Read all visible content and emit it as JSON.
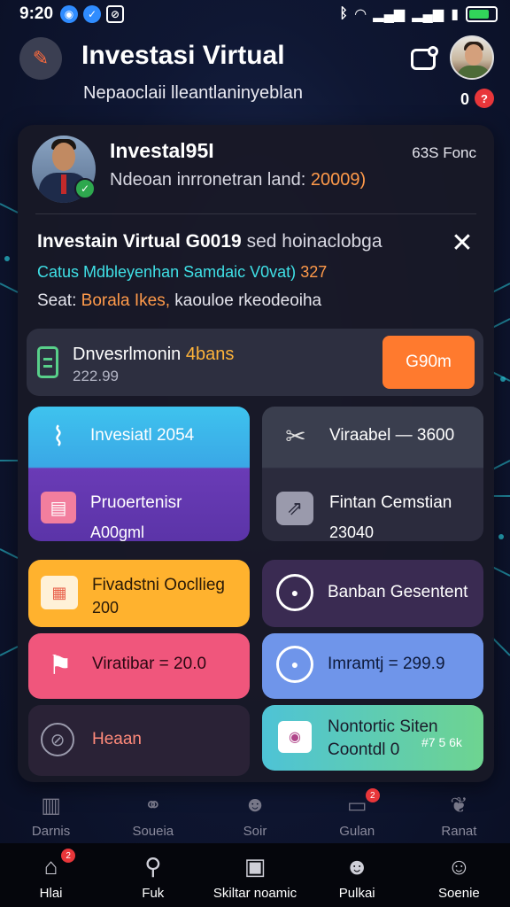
{
  "status_bar": {
    "time": "9:20"
  },
  "header": {
    "title": "Investasi Virtual",
    "subtitle": "Nepaoclaii lleantlaninyeblan",
    "notif_count": "0",
    "notif_badge": "?"
  },
  "profile": {
    "name": "Investal95I",
    "desc_prefix": "Ndeoan inrronetran land: ",
    "desc_value": "20009)",
    "meta": "63S Fonc"
  },
  "info": {
    "title_bold": "Investain Virtual G0019",
    "title_rest": "sed hoinaclobga",
    "line2_prefix": "Catus Mdbleyenhan Samdaic V0vat)",
    "line2_value": "327",
    "line3_prefix": "Seat: ",
    "line3_highlight": "Borala Ikes,",
    "line3_rest": " kaouloe rkeodeoiha",
    "close_label": "✕"
  },
  "invest_row": {
    "title": "Dnvesrlmonin",
    "title_value": "4bans",
    "sub": "222.99",
    "button_label": "G90m"
  },
  "tiles": [
    {
      "label": "Invesiatl 2054"
    },
    {
      "label": "Viraabel — 3600"
    },
    {
      "label": "Pruoertenisr",
      "value": "A00gml"
    },
    {
      "label": "Fintan Cemstian",
      "value": "23040"
    },
    {
      "label": "Fivadstni Oocllieg",
      "value": "200"
    },
    {
      "label": "Banban Gesentent"
    },
    {
      "label": "Viratibar = 20.0"
    },
    {
      "label": "Imramtj = 299.9"
    },
    {
      "label": "Heaan"
    },
    {
      "label": "Nontortic Siten",
      "value": "Coontdl 0",
      "extra": "#7 5 6k"
    }
  ],
  "secondary_tabs": [
    {
      "label": "Darnis",
      "icon": "trash-icon"
    },
    {
      "label": "Soueia",
      "icon": "share-icon"
    },
    {
      "label": "Soir",
      "icon": "user-icon"
    },
    {
      "label": "Gulan",
      "icon": "card-icon",
      "badge": "2"
    },
    {
      "label": "Ranat",
      "icon": "leaf-icon"
    }
  ],
  "nav": [
    {
      "label": "Hlai",
      "icon": "home-icon",
      "badge": "2"
    },
    {
      "label": "Fuk",
      "icon": "search-icon"
    },
    {
      "label": "Skiltar noamic",
      "icon": "window-icon"
    },
    {
      "label": "Pulkai",
      "icon": "person-icon"
    },
    {
      "label": "Soenie",
      "icon": "profile-icon"
    }
  ],
  "colors": {
    "accent": "#ff7a2e",
    "teal": "#3fe0e6",
    "orange_text": "#ff9a4a",
    "battery": "#32d35a"
  }
}
